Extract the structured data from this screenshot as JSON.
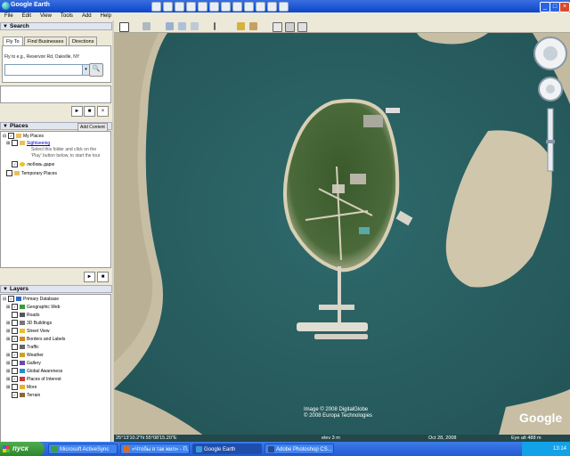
{
  "window": {
    "title": "Google Earth",
    "minimize": "_",
    "maximize": "□",
    "close": "×"
  },
  "menu": [
    "File",
    "Edit",
    "View",
    "Tools",
    "Add",
    "Help"
  ],
  "search": {
    "header": "Search",
    "tabs": [
      "Fly To",
      "Find Businesses",
      "Directions"
    ],
    "hint": "Fly to e.g., Reservoir Rd, Oakville, NY",
    "query": "",
    "go_glyph": "🔍"
  },
  "places": {
    "header": "Places",
    "add_content": "Add Content",
    "items": [
      {
        "label": "My Places",
        "checked": true
      },
      {
        "label": "Sightseeing",
        "checked": false
      },
      {
        "label": "Select this folder and click on the"
      },
      {
        "label": "'Play' button below, to start the tour"
      },
      {
        "label": "любовь дарю",
        "checked": true
      },
      {
        "label": "Temporary Places",
        "checked": false
      }
    ]
  },
  "layers": {
    "header": "Layers",
    "items": [
      {
        "label": "Primary Database",
        "checked": true,
        "color": "#2a6cc8"
      },
      {
        "label": "Geographic Web",
        "checked": true,
        "color": "#3a9a3a"
      },
      {
        "label": "Roads",
        "checked": false,
        "color": "#555555"
      },
      {
        "label": "3D Buildings",
        "checked": false,
        "color": "#777777"
      },
      {
        "label": "Street View",
        "checked": false,
        "color": "#e8c030"
      },
      {
        "label": "Borders and Labels",
        "checked": true,
        "color": "#d08a20"
      },
      {
        "label": "Traffic",
        "checked": false,
        "color": "#666666"
      },
      {
        "label": "Weather",
        "checked": true,
        "color": "#d0a020"
      },
      {
        "label": "Gallery",
        "checked": false,
        "color": "#6a4aa8"
      },
      {
        "label": "Global Awareness",
        "checked": false,
        "color": "#2a8ad0"
      },
      {
        "label": "Places of Interest",
        "checked": true,
        "color": "#c83a3a"
      },
      {
        "label": "More",
        "checked": false,
        "color": "#e8b030"
      },
      {
        "label": "Terrain",
        "checked": true,
        "color": "#8a6a3a"
      }
    ]
  },
  "playback": {
    "play": "►",
    "stop": "■",
    "close": "×"
  },
  "map": {
    "attribution_1": "Image © 2008 DigitalGlobe",
    "attribution_2": "© 2008 Europa Technologies",
    "google_logo": "Google",
    "status_coords": "25°13'10.2\"N   55°08'15.20\"E",
    "status_elev": "elev    3 m",
    "status_date": "Oct 28, 2008",
    "status_eye": "Eye alt   488 m"
  },
  "taskbar": {
    "start": "пуск",
    "tasks": [
      {
        "label": "Microsoft ActiveSync",
        "color": "#3aa03a"
      },
      {
        "label": "«Чтобы я так жил» - П...",
        "color": "#e06a20"
      },
      {
        "label": "Google Earth",
        "color": "#3a9ad8"
      },
      {
        "label": "Adobe Photoshop CS...",
        "color": "#2a4a8a"
      }
    ],
    "clock": "13:14"
  }
}
